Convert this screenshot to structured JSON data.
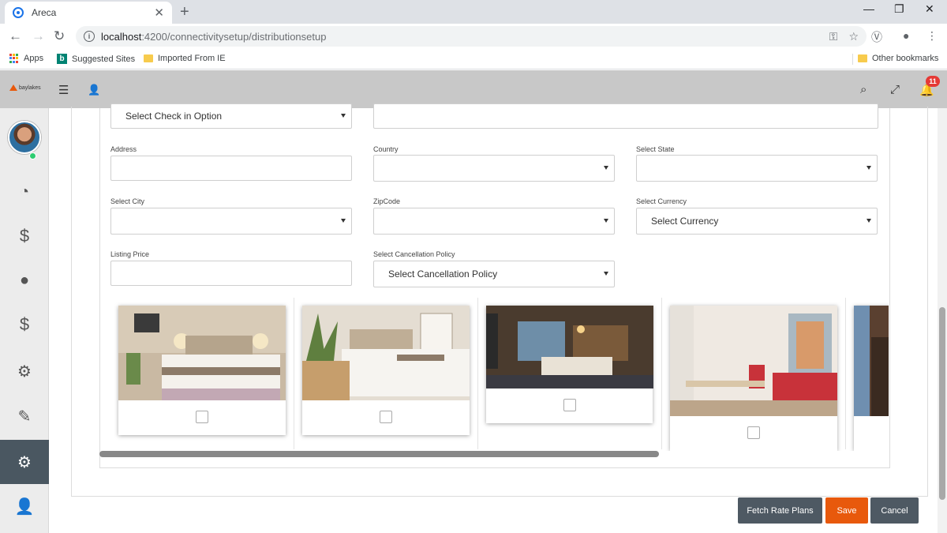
{
  "browser": {
    "tab_title": "Areca",
    "tab_close": "✕",
    "new_tab": "+",
    "url_host": "localhost",
    "url_path": ":4200/connectivitysetup/distributionsetup",
    "bookmarks": {
      "apps": "Apps",
      "suggested": "Suggested Sites",
      "imported": "Imported From IE",
      "other": "Other bookmarks"
    }
  },
  "header": {
    "logo_text": "baylakes",
    "notification_count": "11"
  },
  "form": {
    "checkin_option": "Select Check in Option",
    "address_label": "Address",
    "country_label": "Country",
    "state_label": "Select State",
    "city_label": "Select City",
    "zipcode_label": "ZipCode",
    "currency_label": "Select Currency",
    "currency_value": "Select Currency",
    "listing_price_label": "Listing Price",
    "cancellation_label": "Select Cancellation Policy",
    "cancellation_value": "Select Cancellation Policy"
  },
  "actions": {
    "fetch": "Fetch Rate Plans",
    "save": "Save",
    "cancel": "Cancel"
  },
  "colors": {
    "accent": "#e8590c",
    "dark_button": "#4e5963",
    "active_sidebar": "#4a5761",
    "header_bg": "#c8c8c8"
  },
  "icons": {
    "sidebar": [
      "dashboard-icon",
      "dollar-icon",
      "globe-icon",
      "dollar-icon",
      "gear-icon",
      "edit-icon",
      "gears-icon",
      "user-icon"
    ],
    "header": [
      "menu-icon",
      "user-icon",
      "search-icon",
      "expand-icon",
      "bell-icon"
    ]
  }
}
